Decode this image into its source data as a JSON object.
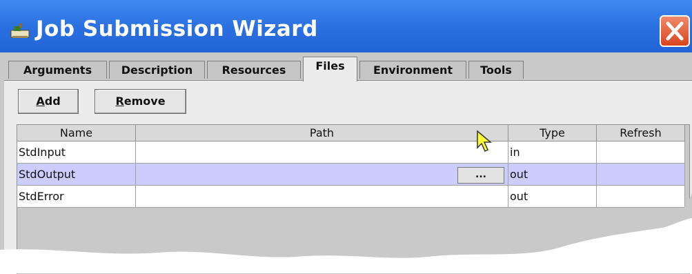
{
  "window": {
    "title": "Job Submission Wizard",
    "icon": "application-icon",
    "close_icon": "close-x-icon"
  },
  "tabs": [
    {
      "label": "Arguments",
      "active": false
    },
    {
      "label": "Description",
      "active": false
    },
    {
      "label": "Resources",
      "active": false
    },
    {
      "label": "Files",
      "active": true
    },
    {
      "label": "Environment",
      "active": false
    },
    {
      "label": "Tools",
      "active": false
    }
  ],
  "toolbar": {
    "add_mnemonic": "A",
    "add_rest": "dd",
    "remove_mnemonic": "R",
    "remove_rest": "emove"
  },
  "table": {
    "columns": [
      "Name",
      "Path",
      "Type",
      "Refresh"
    ],
    "rows": [
      {
        "name": "StdInput",
        "path": "",
        "type": "in",
        "refresh": "",
        "selected": false
      },
      {
        "name": "StdOutput",
        "path": "",
        "type": "out",
        "refresh": "",
        "selected": true
      },
      {
        "name": "StdError",
        "path": "",
        "type": "out",
        "refresh": "",
        "selected": false
      }
    ],
    "browse_label": "..."
  },
  "colors": {
    "titlebar": "#2a6fe0",
    "selected_row": "#ccccff",
    "close_button": "#d8451f"
  }
}
